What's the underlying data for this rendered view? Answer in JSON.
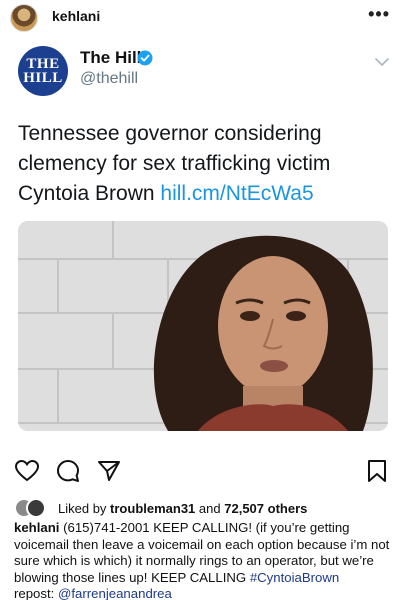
{
  "post": {
    "username": "kehlani",
    "more_icon": "ellipsis-icon"
  },
  "tweet": {
    "logo_text_top": "THE",
    "logo_text_bottom": "HILL",
    "name": "The Hill",
    "handle": "@thehill",
    "text_main": "Tennessee governor considering clemency for sex trafficking victim Cyntoia Brown",
    "link": "hill.cm/NtEcWa5",
    "link_color": "#1b95e0"
  },
  "likes": {
    "prefix": "Liked by",
    "user": "troubleman31",
    "conj": "and",
    "count": "72,507 others"
  },
  "caption": {
    "user": "kehlani",
    "text": "(615)741-2001 KEEP CALLING! (if you’re getting voicemail then leave a voicemail on each option because i’m not sure which is which) it normally rings to an operator, but we’re blowing those lines up! KEEP CALLING",
    "hashtag": "#CyntoiaBrown",
    "repost_label": "repost:",
    "repost_user": "@farrenjeanandrea"
  },
  "colors": {
    "hill_blue": "#1d3f8f",
    "verified_blue": "#1da1f2",
    "mention_blue": "#1e3a8a"
  }
}
